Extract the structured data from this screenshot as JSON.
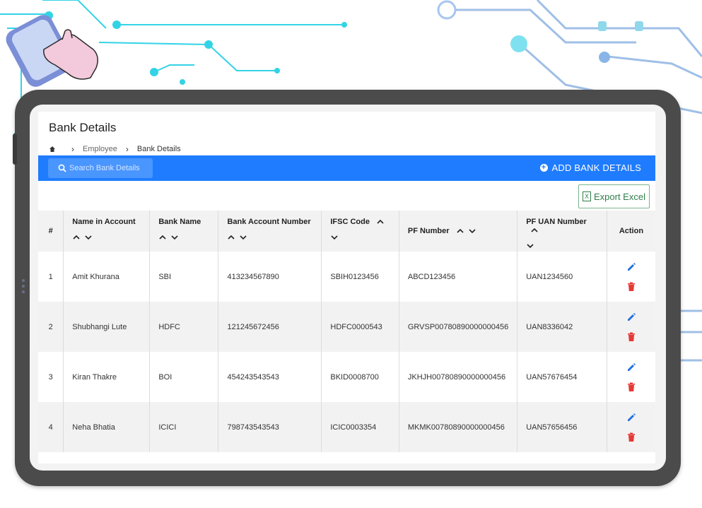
{
  "page": {
    "title": "Bank Details",
    "breadcrumb": {
      "home_icon": "home-icon",
      "items": [
        "Employee",
        "Bank Details"
      ]
    }
  },
  "toolbar": {
    "search_placeholder": "Search Bank Details",
    "add_label": "ADD BANK DETAILS",
    "accent": "#1f7cff"
  },
  "export": {
    "label": "Export Excel"
  },
  "table": {
    "headers": {
      "num": "#",
      "name": "Name in Account",
      "bank": "Bank Name",
      "account": "Bank Account Number",
      "ifsc": "IFSC Code",
      "pf": "PF Number",
      "uan": "PF UAN Number",
      "action": "Action"
    },
    "rows": [
      {
        "num": "1",
        "name": "Amit Khurana",
        "bank": "SBI",
        "account": "413234567890",
        "ifsc": "SBIH0123456",
        "pf": "ABCD123456",
        "uan": "UAN1234560"
      },
      {
        "num": "2",
        "name": "Shubhangi Lute",
        "bank": "HDFC",
        "account": "121245672456",
        "ifsc": "HDFC0000543",
        "pf": "GRVSP00780890000000456",
        "uan": "UAN8336042"
      },
      {
        "num": "3",
        "name": "Kiran Thakre",
        "bank": "BOI",
        "account": "454243543543",
        "ifsc": "BKID0008700",
        "pf": "JKHJH00780890000000456",
        "uan": "UAN57676454"
      },
      {
        "num": "4",
        "name": "Neha Bhatia",
        "bank": "ICICI",
        "account": "798743543543",
        "ifsc": "ICIC0003354",
        "pf": "MKMK00780890000000456",
        "uan": "UAN57656456"
      }
    ]
  }
}
